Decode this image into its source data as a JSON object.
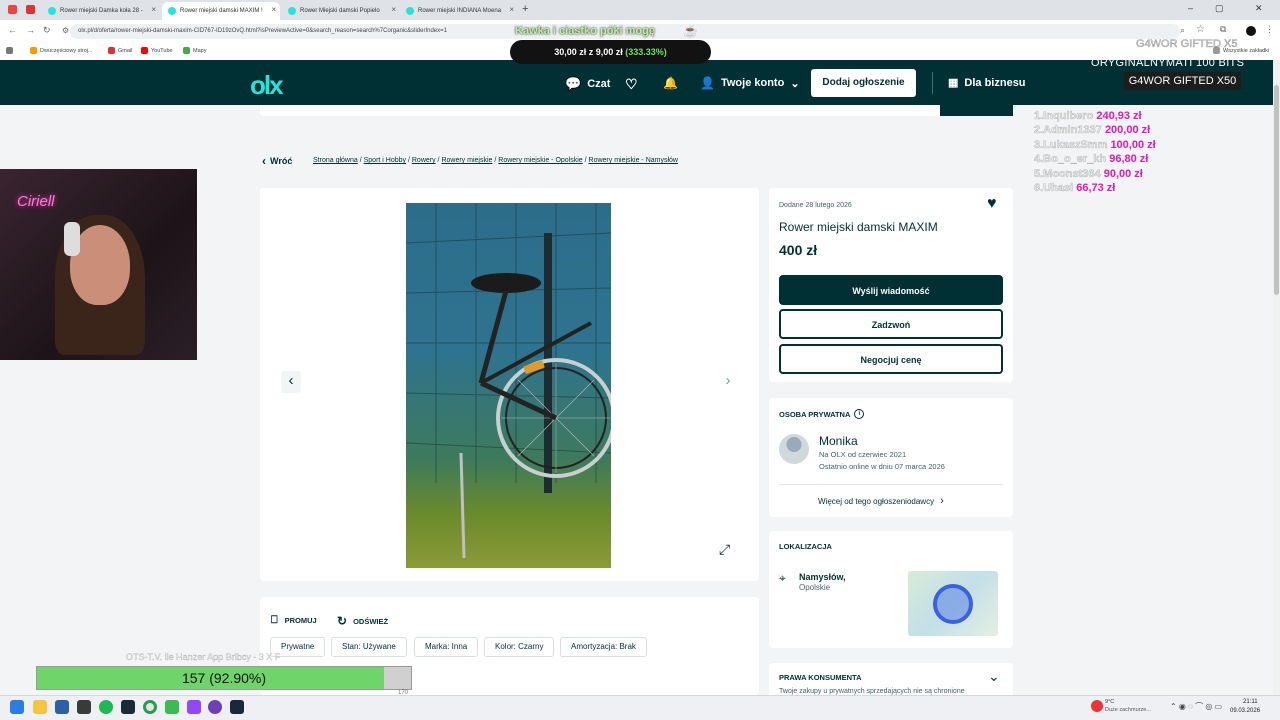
{
  "browser": {
    "tabs": [
      {
        "title": "Rower miejski Damka koła 28 -"
      },
      {
        "title": "Rower miejski damski MAXIM !"
      },
      {
        "title": "Rower Miejski damski Popielo"
      },
      {
        "title": "Rower miejski INDIANA Moena"
      }
    ],
    "url": "olx.pl/d/oferta/rower-miejski-damski-maxim-CID767-ID19zOvQ.html?isPreviewActive=0&search_reason=search%7Corganic&sliderIndex=1",
    "bookmarks": [
      "Dwuczęściowy stroj...",
      "Gmail",
      "YouTube",
      "Mapy"
    ],
    "all_bookmarks": "Wszystkie zakładki"
  },
  "header": {
    "logo": "olx",
    "chat": "Czat",
    "account": "Twoje konto",
    "add_listing": "Dodaj ogłoszenie",
    "business": "Dla biznesu"
  },
  "breadcrumb": {
    "back": "Wróć",
    "items": [
      "Strona główna",
      "Sport i Hobby",
      "Rowery",
      "Rowery miejskie",
      "Rowery miejskie - Opolskie",
      "Rowery miejskie - Namysłów"
    ]
  },
  "listing": {
    "added": "Dodane 28 lutego 2026",
    "title": "Rower miejski damski MAXIM",
    "price": "400 zł",
    "send_message": "Wyślij wiadomość",
    "call": "Zadzwoń",
    "negotiate": "Negocjuj cenę",
    "promote": "PROMUJ",
    "refresh": "ODŚWIEŻ",
    "tags": [
      "Prywatne",
      "Stan: Używane",
      "Marka: Inna",
      "Kolor: Czarny",
      "Amortyzacja: Brak"
    ]
  },
  "seller": {
    "heading": "OSOBA PRYWATNA",
    "name": "Monika",
    "since": "Na OLX od czerwiec 2021",
    "last_online": "Ostatnio online w dniu 07 marca 2026",
    "more_link": "Więcej od tego ogłoszeniodawcy"
  },
  "location": {
    "heading": "LOKALIZACJA",
    "city": "Namysłów,",
    "region": "Opolskie"
  },
  "consumer": {
    "heading": "PRAWA KONSUMENTA",
    "text": "Twoje zakupy u prywatnych sprzedających nie są chronione"
  },
  "overlay": {
    "goal_text": "Kawka i ciastko póki mogę",
    "goal_amount": "30,00 zł z 9,00 zł",
    "goal_percent": "(333.33%)",
    "gifted_top": "G4WOR GIFTED X5",
    "bits": "ORYGINALNYMATI 100 BITS",
    "gifted_banner": "G4WOR GIFTED X50",
    "leaderboard": [
      {
        "name": "1.Inquibero",
        "value": "240,93 zł"
      },
      {
        "name": "2.Admin1337",
        "value": "200,00 zł"
      },
      {
        "name": "3.LukaszSmm",
        "value": "100,00 zł"
      },
      {
        "name": "4.Bo_o_er_kh",
        "value": "96,80 zł"
      },
      {
        "name": "5.Moonst364",
        "value": "90,00 zł"
      },
      {
        "name": "6.Uhasi",
        "value": "66,73 zł"
      }
    ],
    "neon": "Ciriell",
    "progress_caption": "OTS-T.V. ile Hanzer App Bribcy - 3 X F",
    "progress_label": "157 (92.90%)",
    "progress_fraction": 0.929,
    "progress_end": "170"
  },
  "taskbar": {
    "weather": "9°C",
    "weather_sub": "Duże zachmurze...",
    "time": "21:11",
    "date": "09.03.2026"
  }
}
